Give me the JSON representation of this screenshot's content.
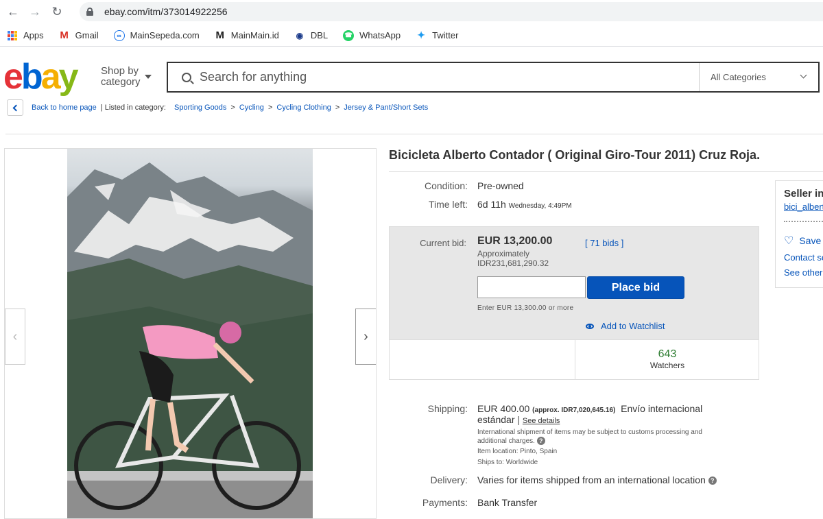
{
  "browser": {
    "url": "ebay.com/itm/373014922256",
    "bookmarks": [
      {
        "label": "Apps",
        "icon": "apps-grid-icon"
      },
      {
        "label": "Gmail",
        "icon": "gmail-icon"
      },
      {
        "label": "MainSepeda.com",
        "icon": "mainsepeda-icon"
      },
      {
        "label": "MainMain.id",
        "icon": "mainmain-icon"
      },
      {
        "label": "DBL",
        "icon": "dbl-icon"
      },
      {
        "label": "WhatsApp",
        "icon": "whatsapp-icon"
      },
      {
        "label": "Twitter",
        "icon": "twitter-icon"
      }
    ]
  },
  "header": {
    "logo": {
      "e": "e",
      "b": "b",
      "a": "a",
      "y": "y"
    },
    "shop_by": "Shop by",
    "category": "category",
    "search_placeholder": "Search for anything",
    "categories_select": "All Categories"
  },
  "breadcrumb": {
    "back": "Back to home page",
    "listed": "| Listed in category:",
    "items": [
      "Sporting Goods",
      "Cycling",
      "Cycling Clothing",
      "Jersey & Pant/Short Sets"
    ],
    "separator": ">"
  },
  "item": {
    "title": "Bicicleta Alberto Contador ( Original Giro-Tour 2011)  Cruz Roja.",
    "condition_label": "Condition:",
    "condition": "Pre-owned",
    "time_left_label": "Time left:",
    "time_left": "6d 11h",
    "time_end": "Wednesday, 4:49PM",
    "current_bid_label": "Current bid:",
    "current_bid": "EUR 13,200.00",
    "approx_label": "Approximately",
    "approx_value": "IDR231,681,290.32",
    "bids": "[ 71 bids ]",
    "place_bid": "Place bid",
    "enter_note": "Enter EUR 13,300.00 or more",
    "add_watchlist": "Add to Watchlist",
    "watchers_count": "643",
    "watchers_label": "Watchers",
    "shipping_label": "Shipping:",
    "shipping_price": "EUR 400.00",
    "shipping_approx": "(approx. IDR7,020,645.16)",
    "shipping_method_1": "Envío internacional",
    "shipping_method_2": "estándar",
    "see_details": "See details",
    "intl_note_1": "International shipment of items may be subject to customs processing and",
    "intl_note_2": "additional charges.",
    "item_location": "Item location:  Pinto, Spain",
    "ships_to": "Ships to:  Worldwide",
    "delivery_label": "Delivery:",
    "delivery": "Varies for items shipped from an international location",
    "payments_label": "Payments:",
    "payments": "Bank Transfer"
  },
  "seller": {
    "heading": "Seller information",
    "name": "bici_alberto",
    "save": "Save this seller",
    "contact": "Contact seller",
    "see_other": "See other items"
  },
  "colors": {
    "ebay_blue": "#0654ba",
    "watchers_green": "#2e7d32"
  }
}
